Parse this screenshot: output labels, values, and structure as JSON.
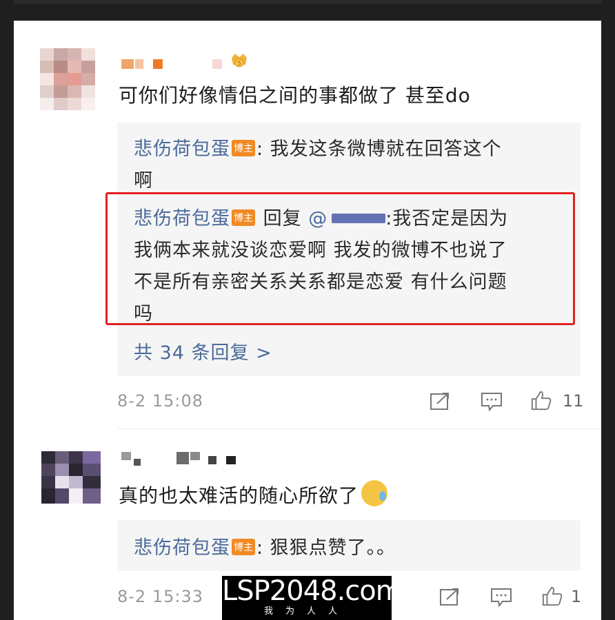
{
  "comments": [
    {
      "text": "可你们好像情侣之间的事都做了 甚至do",
      "replies": [
        {
          "author": "悲伤荷包蛋",
          "badge": "博主",
          "lines": [
            ": 我发这条微博就在回答这个",
            "啊"
          ]
        },
        {
          "author": "悲伤荷包蛋",
          "badge": "博主",
          "reply_label": "回复",
          "mention": "@",
          "lines": [
            ":我否定是因为",
            "我俩本来就没谈恋爱啊 我发的微博不也说了",
            "不是所有亲密关系关系都是恋爱 有什么问题",
            "吗"
          ]
        }
      ],
      "more_replies": "共 34 条回复 >",
      "time": "8-2 15:08",
      "like_count": "11",
      "crown_level": "5"
    },
    {
      "text": "真的也太难活的随心所欲了",
      "replies": [
        {
          "author": "悲伤荷包蛋",
          "badge": "博主",
          "lines": [
            ": 狠狠点赞了。。"
          ]
        }
      ],
      "time": "8-2 15:33",
      "like_count": "1"
    }
  ],
  "icons": {
    "share": "share-icon",
    "comment": "comment-icon",
    "like": "thumbs-up-icon"
  },
  "watermark": {
    "main": "LSP2048.com",
    "sub": "我为人人"
  },
  "colors": {
    "author": "#4a6a9a",
    "badge": "#f08a24",
    "highlight": "#e02020"
  }
}
